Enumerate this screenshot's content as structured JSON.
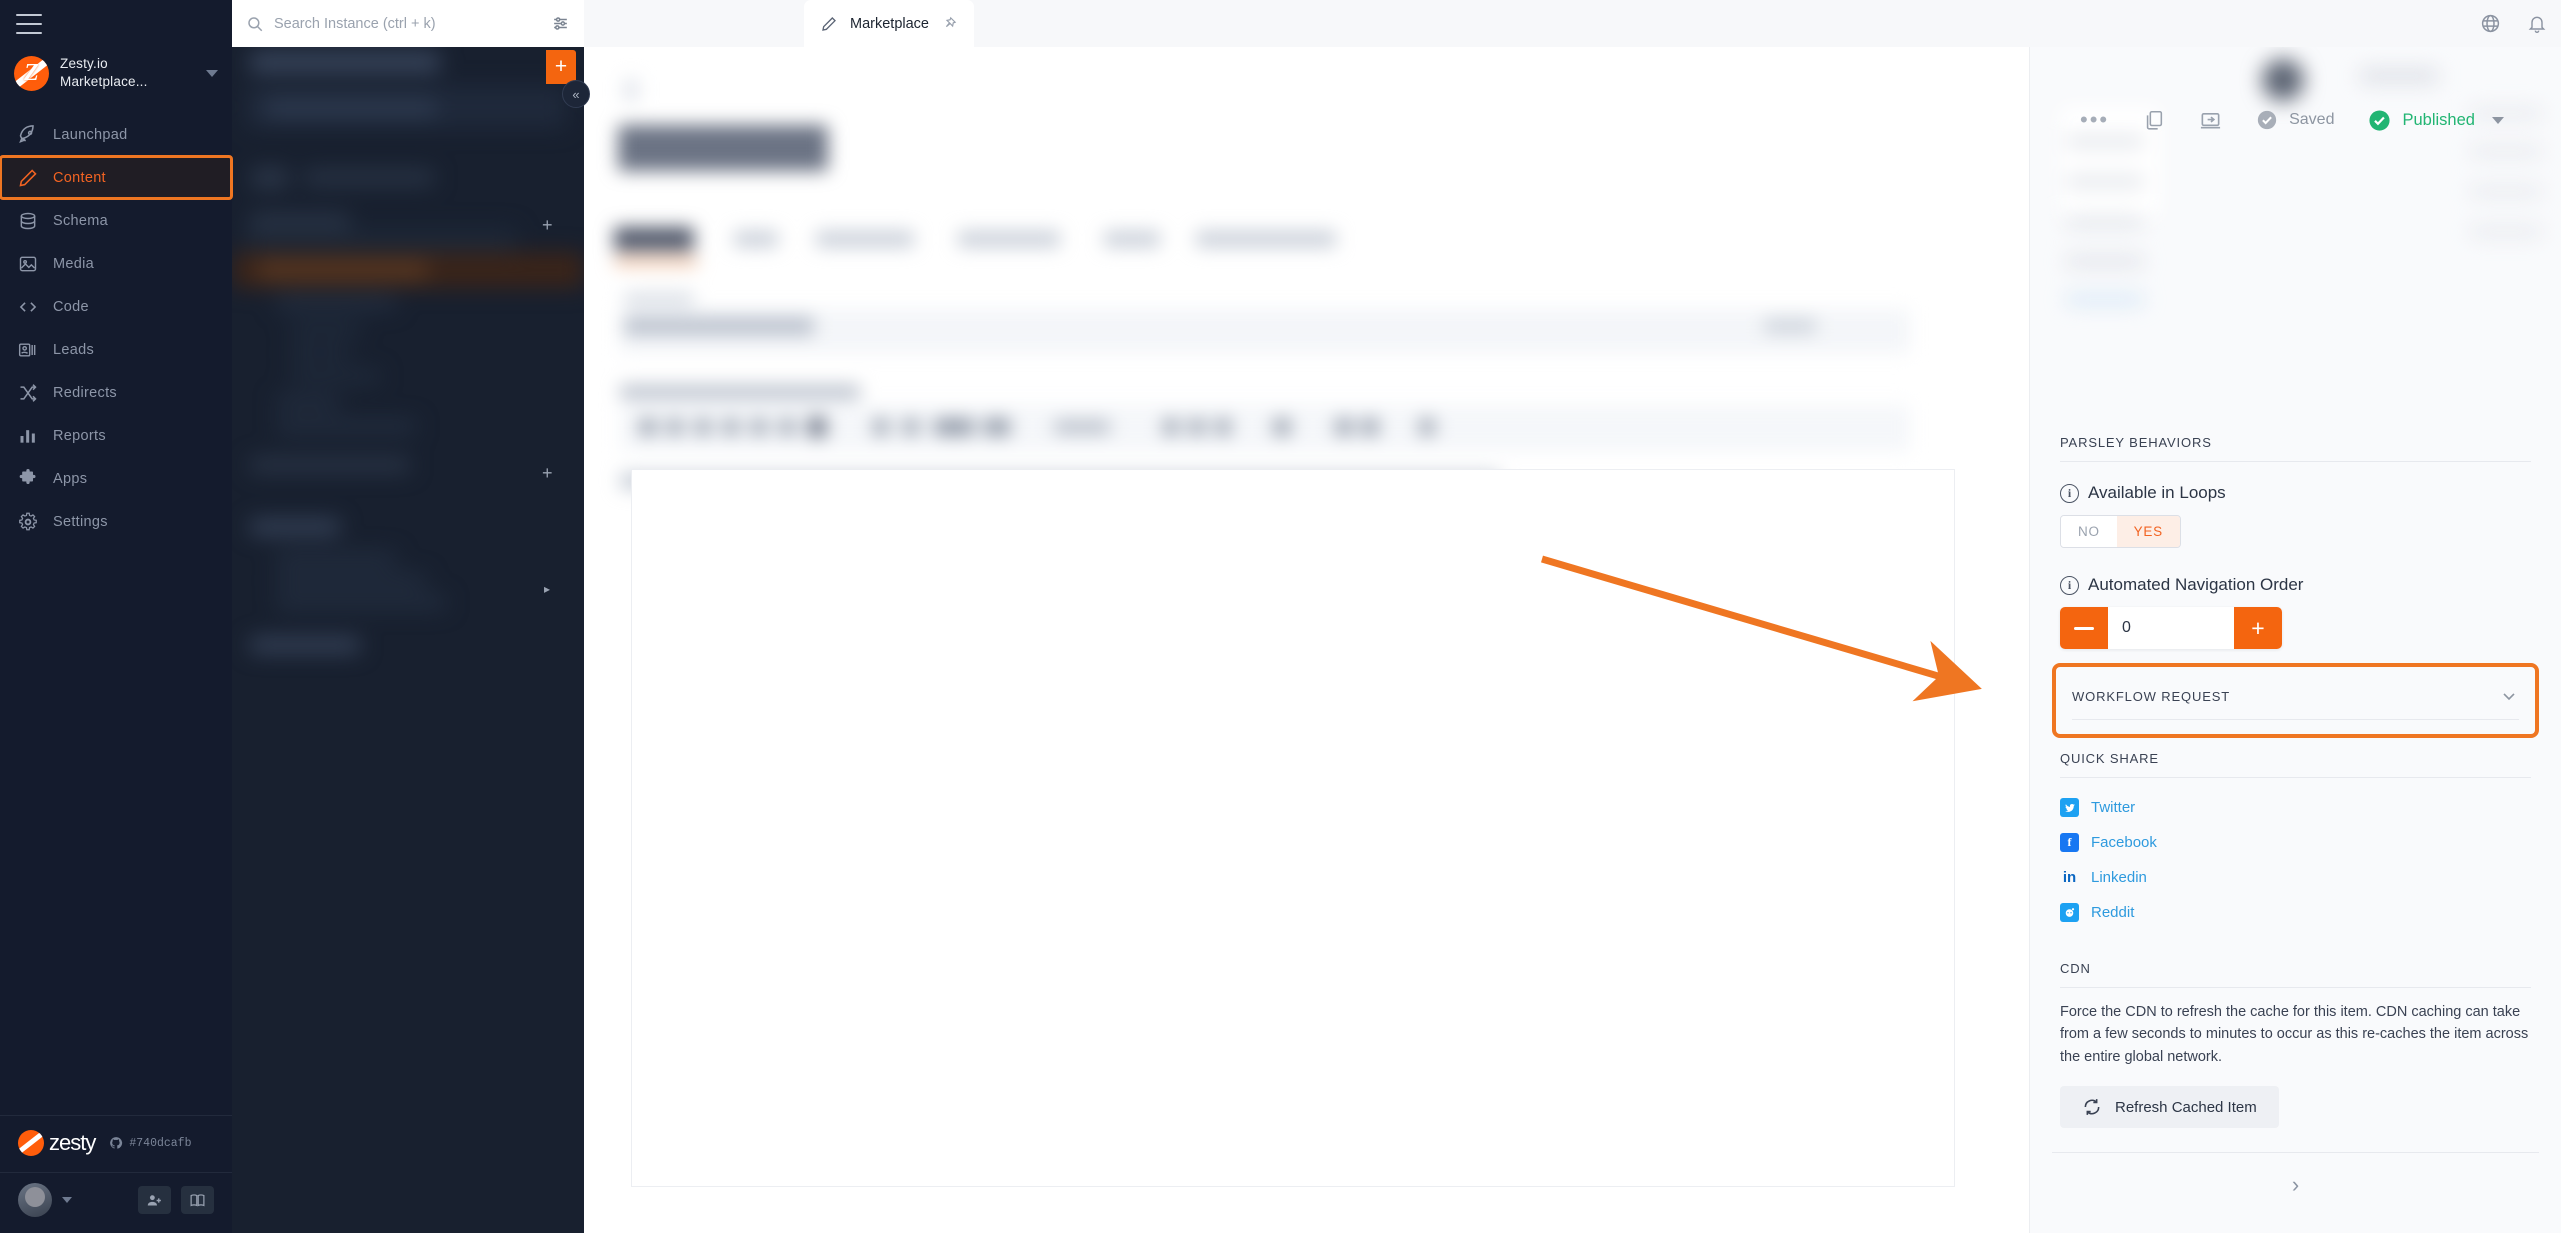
{
  "topbar": {
    "search": {
      "placeholder": "Search Instance (ctrl + k)",
      "value": ""
    },
    "filter_icon": "sliders-icon",
    "tab": {
      "label": "Marketplace",
      "icon": "pencil-icon",
      "pin_icon": "pin-icon"
    },
    "globe_icon": "globe-icon",
    "bell_icon": "bell-icon"
  },
  "sidebar": {
    "menu_icon": "hamburger-icon",
    "instance": {
      "line1": "Zesty.io",
      "line2": "Marketplace...",
      "logo": "zesty-logo-icon"
    },
    "items": [
      {
        "label": "Launchpad",
        "icon": "rocket-icon"
      },
      {
        "label": "Content",
        "icon": "pencil-icon"
      },
      {
        "label": "Schema",
        "icon": "database-icon"
      },
      {
        "label": "Media",
        "icon": "image-icon"
      },
      {
        "label": "Code",
        "icon": "code-brackets-icon"
      },
      {
        "label": "Leads",
        "icon": "contact-card-icon"
      },
      {
        "label": "Redirects",
        "icon": "shuffle-icon"
      },
      {
        "label": "Reports",
        "icon": "bar-chart-icon"
      },
      {
        "label": "Apps",
        "icon": "puzzle-icon"
      },
      {
        "label": "Settings",
        "icon": "gear-icon"
      }
    ],
    "active_item": "Content",
    "brand": "zesty",
    "commit": "#740dcafb",
    "commit_icon": "github-icon",
    "add_user_icon": "add-user-icon",
    "docs_icon": "book-icon"
  },
  "content_tree": {
    "add_button": "+",
    "collapse_button": "«",
    "add_item_icon": "+"
  },
  "editor_toolbar": {
    "saved_label": "Saved",
    "published_label": "Published",
    "more_icon": "ellipsis-icon",
    "copy_icon": "copy-icon",
    "preview_icon": "preview-icon",
    "saved_icon": "check-circle-icon",
    "published_icon": "check-circle-filled-icon",
    "dropdown_icon": "caret-down-icon"
  },
  "right_panel": {
    "parsley": {
      "title": "PARSLEY BEHAVIORS",
      "available_in_loops": {
        "label": "Available in Loops",
        "info_icon": "info-icon",
        "options": [
          "NO",
          "YES"
        ],
        "selected": "YES"
      },
      "nav_order": {
        "label": "Automated Navigation Order",
        "info_icon": "info-icon",
        "value": "0",
        "decrement": "—",
        "increment": "+"
      }
    },
    "workflow": {
      "title": "WORKFLOW REQUEST",
      "chevron_icon": "chevron-down-icon"
    },
    "quick_share": {
      "title": "QUICK SHARE",
      "items": [
        {
          "label": "Twitter",
          "icon": "twitter-icon",
          "color": "#1da1f2"
        },
        {
          "label": "Facebook",
          "icon": "facebook-icon",
          "color": "#1877f2"
        },
        {
          "label": "Linkedin",
          "icon": "linkedin-icon",
          "color": "#0a66c2"
        },
        {
          "label": "Reddit",
          "icon": "reddit-icon",
          "color": "#ff4500"
        }
      ]
    },
    "cdn": {
      "title": "CDN",
      "description": "Force the CDN to refresh the cache for this item. CDN caching can take from a few seconds to minutes to occur as this re-caches the item across the entire global network.",
      "button_label": "Refresh Cached Item",
      "button_icon": "refresh-icon"
    },
    "footer_chevron": "›"
  },
  "annotation": {
    "arrow_color": "#ef7622",
    "highlight_color": "#ef7622"
  },
  "colors": {
    "brand_orange": "#f26322",
    "nav_dark": "#141b2d",
    "published_green": "#22b573",
    "saved_gray": "#a8aeb8",
    "link_blue": "#2e9ade"
  }
}
